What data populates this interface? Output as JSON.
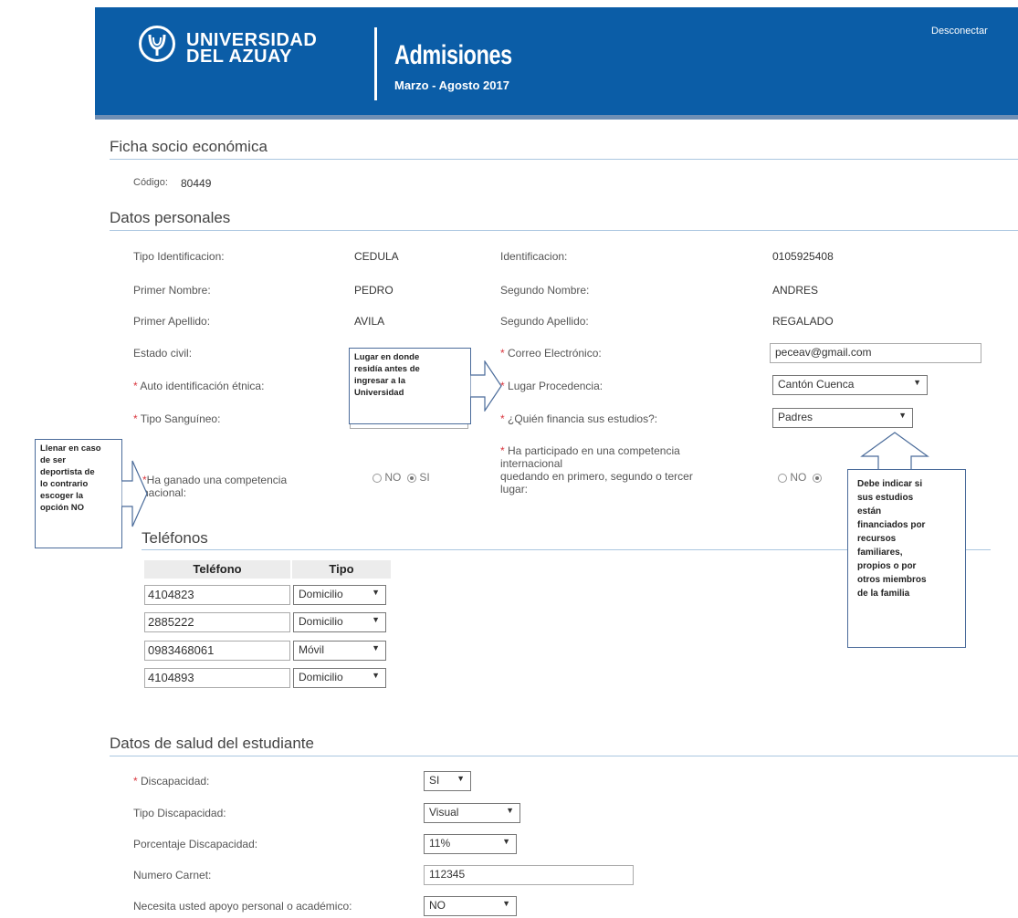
{
  "header": {
    "university_line1": "UNIVERSIDAD",
    "university_line2": "DEL AZUAY",
    "app_title": "Admisiones",
    "period": "Marzo - Agosto 2017",
    "logout": "Desconectar"
  },
  "page_title": "Ficha socio económica",
  "code": {
    "label": "Código:",
    "value": "80449"
  },
  "personal": {
    "title": "Datos personales",
    "tipo_id_label": "Tipo Identificacion:",
    "tipo_id_value": "CEDULA",
    "id_label": "Identificacion:",
    "id_value": "0105925408",
    "primer_nombre_label": "Primer Nombre:",
    "primer_nombre_value": "PEDRO",
    "segundo_nombre_label": "Segundo Nombre:",
    "segundo_nombre_value": "ANDRES",
    "primer_apellido_label": "Primer Apellido:",
    "primer_apellido_value": "AVILA",
    "segundo_apellido_label": "Segundo Apellido:",
    "segundo_apellido_value": "REGALADO",
    "estado_civil_label": "Estado civil:",
    "correo_label": "Correo Electrónico:",
    "correo_value": "peceav@gmail.com",
    "etnia_label": "Auto identificación étnica:",
    "procedencia_label": "Lugar Procedencia:",
    "procedencia_value": "Cantón Cuenca",
    "sangre_label": "Tipo Sanguíneo:",
    "financia_label": "¿Quién financia sus estudios?:",
    "financia_value": "Padres",
    "comp_nac_label_1": "Ha ganado una competencia",
    "comp_nac_label_2": "nacional:",
    "comp_int_label_1": "Ha participado en una competencia",
    "comp_int_label_2": "internacional",
    "comp_int_label_3": "quedando en primero, segundo o tercer",
    "comp_int_label_4": "lugar:",
    "opt_no": "NO",
    "opt_si": "SI",
    "required_mark": "*"
  },
  "phones": {
    "title": "Teléfonos",
    "col_phone": "Teléfono",
    "col_type": "Tipo",
    "rows": [
      {
        "number": "4104823",
        "type": "Domicilio"
      },
      {
        "number": "2885222",
        "type": "Domicilio"
      },
      {
        "number": "0983468061",
        "type": "Móvil"
      },
      {
        "number": "4104893",
        "type": "Domicilio"
      }
    ]
  },
  "health": {
    "title": "Datos de salud del estudiante",
    "discapacidad_label": "Discapacidad:",
    "discapacidad_value": "SI",
    "tipo_label": "Tipo Discapacidad:",
    "tipo_value": "Visual",
    "porcentaje_label": "Porcentaje Discapacidad:",
    "porcentaje_value": "11%",
    "carnet_label": "Numero Carnet:",
    "carnet_value": "112345",
    "apoyo_label": "Necesita usted apoyo personal o académico:",
    "apoyo_value": "NO"
  },
  "callouts": {
    "lugar": [
      "Lugar en donde",
      "residía antes de",
      "ingresar a la",
      "Universidad"
    ],
    "deportista": [
      "Llenar en caso",
      "de ser",
      "deportista de",
      "lo contrario",
      "escoger la",
      "opción NO"
    ],
    "financia": [
      "Debe indicar si",
      "sus estudios",
      "están",
      "financiados por",
      "recursos",
      "familiares,",
      "propios o por",
      "otros miembros",
      "de la familia"
    ]
  },
  "icons": {
    "select_arrow": "▼"
  },
  "colors": {
    "header_bg": "#0b5da7",
    "required": "#d9363e",
    "callout_border": "#4a6b9a"
  }
}
